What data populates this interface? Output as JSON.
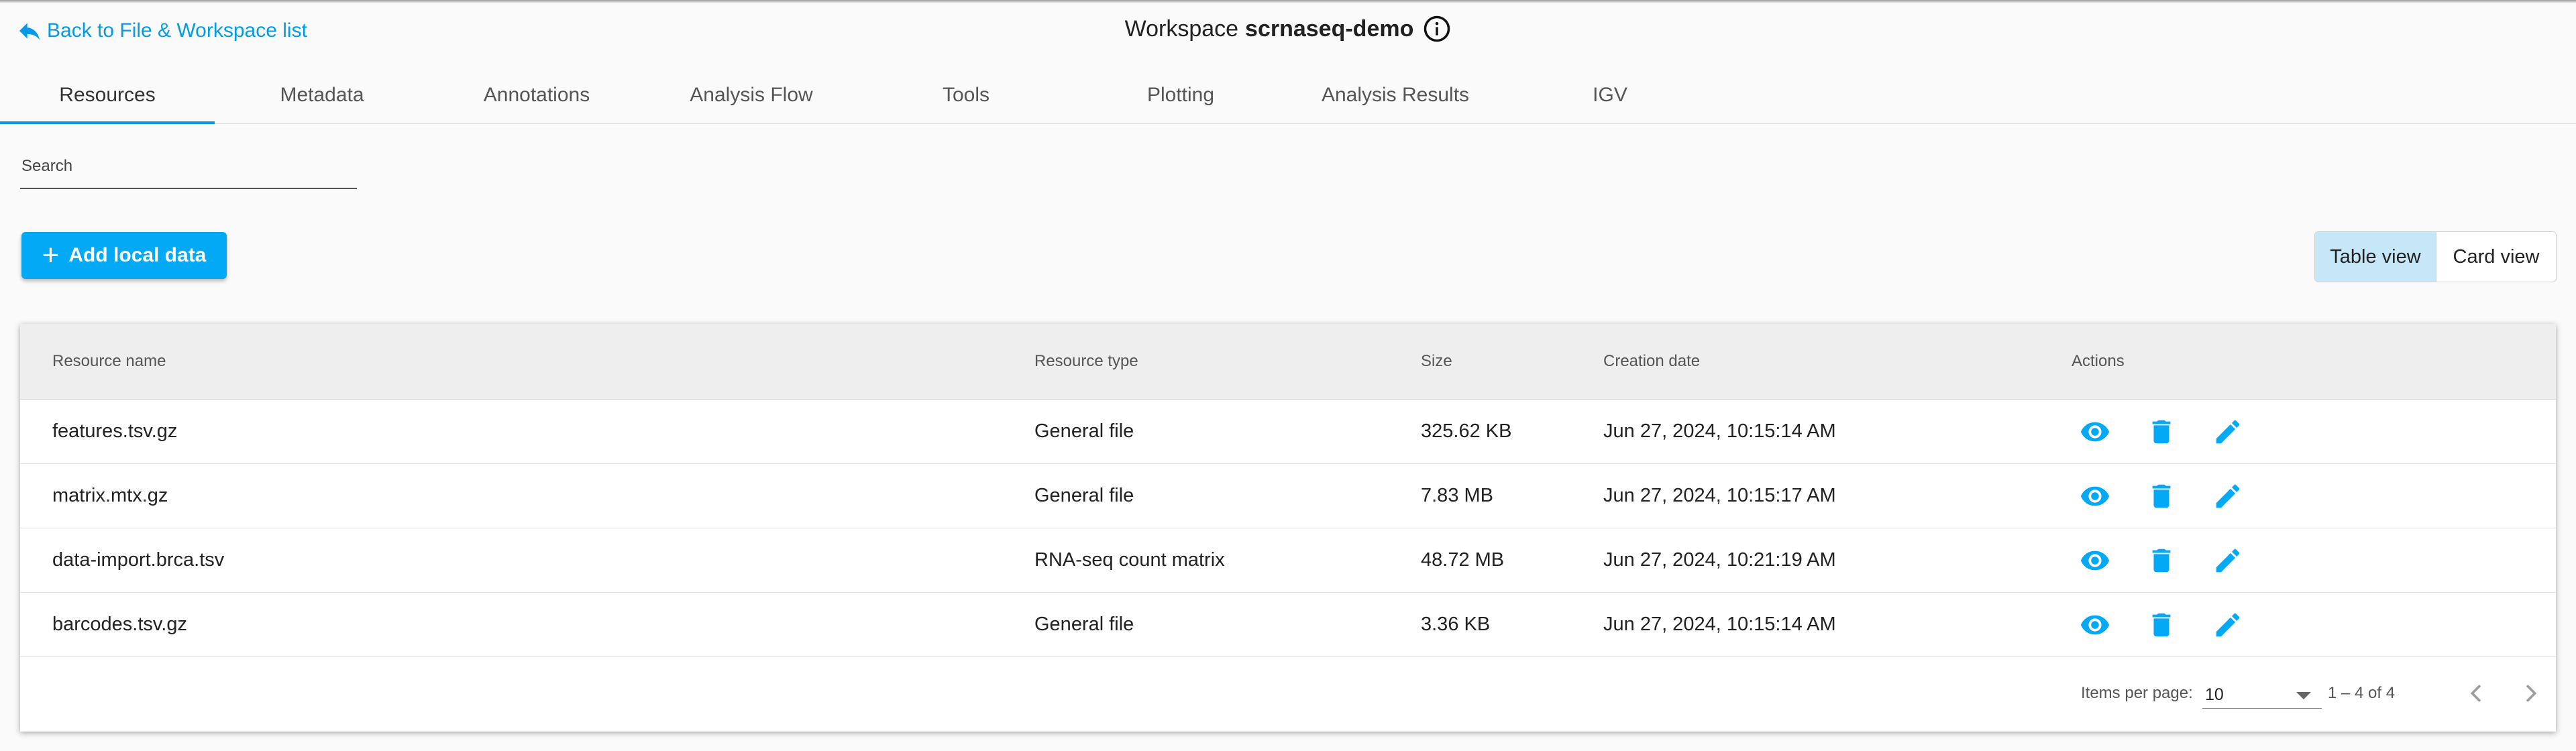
{
  "header": {
    "back_label": "Back to File & Workspace list",
    "workspace_prefix": "Workspace",
    "workspace_name": "scrnaseq-demo"
  },
  "tabs": [
    {
      "label": "Resources",
      "active": true
    },
    {
      "label": "Metadata"
    },
    {
      "label": "Annotations"
    },
    {
      "label": "Analysis Flow"
    },
    {
      "label": "Tools"
    },
    {
      "label": "Plotting"
    },
    {
      "label": "Analysis Results"
    },
    {
      "label": "IGV"
    }
  ],
  "search": {
    "label": "Search",
    "value": ""
  },
  "add_button": {
    "label": "Add local data"
  },
  "view_toggle": {
    "table_label": "Table view",
    "card_label": "Card view",
    "selected": "Table view"
  },
  "table": {
    "columns": [
      "Resource name",
      "Resource type",
      "Size",
      "Creation date",
      "Actions"
    ],
    "rows": [
      {
        "name": "features.tsv.gz",
        "type": "General file",
        "size": "325.62 KB",
        "date": "Jun 27, 2024, 10:15:14 AM"
      },
      {
        "name": "matrix.mtx.gz",
        "type": "General file",
        "size": "7.83 MB",
        "date": "Jun 27, 2024, 10:15:17 AM"
      },
      {
        "name": "data-import.brca.tsv",
        "type": "RNA-seq count matrix",
        "size": "48.72 MB",
        "date": "Jun 27, 2024, 10:21:19 AM"
      },
      {
        "name": "barcodes.tsv.gz",
        "type": "General file",
        "size": "3.36 KB",
        "date": "Jun 27, 2024, 10:15:14 AM"
      }
    ]
  },
  "paginator": {
    "items_per_page_label": "Items per page:",
    "items_per_page_value": "10",
    "range_label": "1 – 4 of 4"
  },
  "colors": {
    "accent": "#03a9f4",
    "link": "#039be5",
    "selected_toggle": "#c6e7f8"
  }
}
